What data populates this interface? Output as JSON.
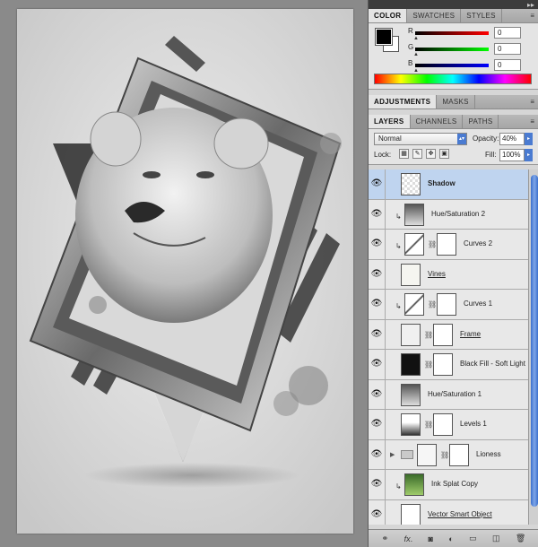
{
  "color_panel": {
    "tabs": [
      "COLOR",
      "SWATCHES",
      "STYLES"
    ],
    "active_tab": "COLOR",
    "channels": [
      {
        "label": "R",
        "value": "0",
        "gradient_end": "#ff0000"
      },
      {
        "label": "G",
        "value": "0",
        "gradient_end": "#00ff00"
      },
      {
        "label": "B",
        "value": "0",
        "gradient_end": "#0000ff"
      }
    ],
    "foreground": "#000000",
    "background": "#ffffff"
  },
  "adjustments_bar": {
    "tabs": [
      "ADJUSTMENTS",
      "MASKS"
    ]
  },
  "layers_panel": {
    "tabs": [
      "LAYERS",
      "CHANNELS",
      "PATHS"
    ],
    "blend_mode": "Normal",
    "opacity_label": "Opacity:",
    "opacity_value": "40%",
    "lock_label": "Lock:",
    "fill_label": "Fill:",
    "fill_value": "100%",
    "layers": [
      {
        "name": "Shadow",
        "selected": true,
        "clipped": false,
        "mask": false,
        "style": "bold"
      },
      {
        "name": "Hue/Saturation 2",
        "selected": false,
        "clipped": true,
        "mask": false,
        "style": "normal"
      },
      {
        "name": "Curves 2",
        "selected": false,
        "clipped": true,
        "mask": true,
        "style": "normal"
      },
      {
        "name": "Vines",
        "selected": false,
        "clipped": false,
        "mask": false,
        "style": "underline"
      },
      {
        "name": "Curves 1",
        "selected": false,
        "clipped": true,
        "mask": true,
        "style": "normal"
      },
      {
        "name": "Frame",
        "selected": false,
        "clipped": false,
        "mask": true,
        "style": "underline"
      },
      {
        "name": "Black Fill - Soft Light",
        "selected": false,
        "clipped": false,
        "mask": true,
        "style": "normal"
      },
      {
        "name": "Hue/Saturation 1",
        "selected": false,
        "clipped": false,
        "mask": false,
        "style": "normal"
      },
      {
        "name": "Levels 1",
        "selected": false,
        "clipped": false,
        "mask": true,
        "style": "normal"
      },
      {
        "name": "Lioness",
        "selected": false,
        "clipped": false,
        "mask": true,
        "style": "normal"
      },
      {
        "name": "Ink Splat Copy",
        "selected": false,
        "clipped": true,
        "mask": false,
        "style": "normal"
      },
      {
        "name": "Vector Smart Object",
        "selected": false,
        "clipped": false,
        "mask": false,
        "style": "underline"
      }
    ]
  },
  "footer_icons": [
    "link-icon",
    "fx-icon",
    "mask-icon",
    "adjustment-icon",
    "folder-icon",
    "new-layer-icon",
    "trash-icon"
  ],
  "accent_color": "#4a7bd1",
  "selected_row_color": "#bfd4ef"
}
